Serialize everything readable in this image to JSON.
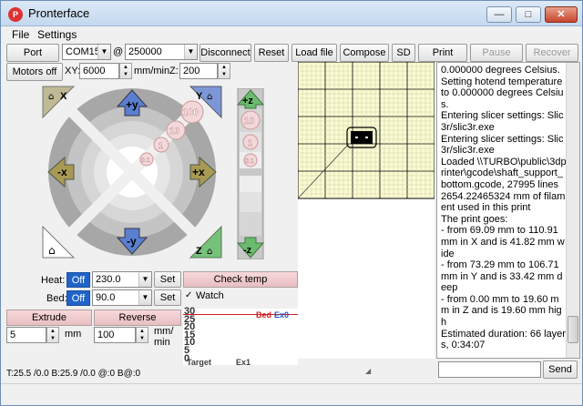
{
  "window": {
    "title": "Pronterface",
    "icon_text": "P",
    "controls": {
      "minimize": "—",
      "maximize": "□",
      "close": "✕"
    }
  },
  "menubar": {
    "file": "File",
    "settings": "Settings"
  },
  "toolbar": {
    "port_label": "Port",
    "port_value": "COM15",
    "at_label": "@",
    "baud_value": "250000",
    "disconnect": "Disconnect",
    "reset": "Reset",
    "load_file": "Load file",
    "compose": "Compose",
    "sd": "SD",
    "print": "Print",
    "pause": "Pause",
    "recover": "Recover"
  },
  "motion": {
    "motors_off": "Motors off",
    "xy_label": "XY:",
    "xy_value": "6000",
    "units_label": "mm/min",
    "z_label": "Z:",
    "z_value": "200"
  },
  "jog": {
    "home_x": "X",
    "home_y": "Y",
    "home_z": "Z",
    "plus_y": "+y",
    "minus_y": "-y",
    "plus_x": "+x",
    "minus_x": "-x",
    "steps": [
      "100",
      "10",
      "1",
      "0.1"
    ],
    "z_plus": "+z",
    "z_minus": "-z",
    "z_steps": [
      "10",
      "1",
      "0.1"
    ]
  },
  "temps": {
    "heat_label": "Heat:",
    "heat_off": "Off",
    "heat_value": "230.0",
    "bed_label": "Bed:",
    "bed_off": "Off",
    "bed_value": "90.0",
    "set_label": "Set",
    "check_temp": "Check temp",
    "watch_label": "Watch",
    "watch_checked": "✓"
  },
  "extrude": {
    "extrude_label": "Extrude",
    "reverse_label": "Reverse",
    "length_value": "5",
    "length_unit": "mm",
    "speed_value": "100",
    "speed_unit_1": "mm/",
    "speed_unit_2": "min"
  },
  "temp_graph": {
    "y_ticks": [
      "30",
      "25",
      "20",
      "15",
      "10",
      "5",
      "0"
    ],
    "legend_bed": "Bed",
    "legend_ex0": "Ex0",
    "legend_target": "Target",
    "legend_ex1": "Ex1",
    "colors": {
      "bed": "#d02020",
      "ex0": "#2050d0",
      "target": "#404040",
      "ex1": "#404040"
    }
  },
  "console": {
    "lines": "0.000000 degrees Celsius.\nSetting hotend temperature to 0.000000 degrees Celsius.\nEntering slicer settings: Slic3r/slic3r.exe\nEntering slicer settings: Slic3r/slic3r.exe\nLoaded \\\\TURBO\\public\\3dprinter\\gcode\\shaft_support_bottom.gcode, 27995 lines\n2654.22465324 mm of filament used in this print\nThe print goes:\n- from 69.09 mm to 110.91 mm in X and is 41.82 mm wide\n- from 73.29 mm to 106.71 mm in Y and is 33.42 mm deep\n- from 0.00 mm to 19.60 mm in Z and is 19.60 mm high\nEstimated duration: 66 layers, 0:34:07",
    "send_label": "Send",
    "command_value": ""
  },
  "status": {
    "text": "T:25.5 /0.0 B:25.9 /0.0 @:0 B@:0"
  },
  "colors": {
    "grid_bg": "#fbfbd2",
    "grid_major": "#000000",
    "grid_minor": "#c8c8a0",
    "jog_y": "#4f73c8",
    "jog_x": "#9c8f4a",
    "jog_z": "#4caf50",
    "off_blue": "#2064c8",
    "pink": "#efc8cb"
  }
}
